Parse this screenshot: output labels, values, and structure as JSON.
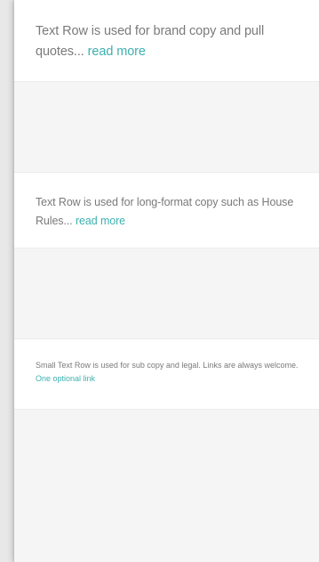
{
  "rows": {
    "brand": {
      "text": "Text Row is used for brand copy and pull quotes...",
      "link": "read more"
    },
    "longform": {
      "text": "Text Row is used for long-format copy such as House Rules...",
      "link": "read more"
    },
    "small": {
      "text": "Small Text Row is used for sub copy and legal. Links are always welcome.",
      "link": "One optional link"
    }
  },
  "colors": {
    "text": "#7a7a7a",
    "link": "#3fb0b0",
    "background": "#f5f5f5",
    "row": "#ffffff"
  }
}
